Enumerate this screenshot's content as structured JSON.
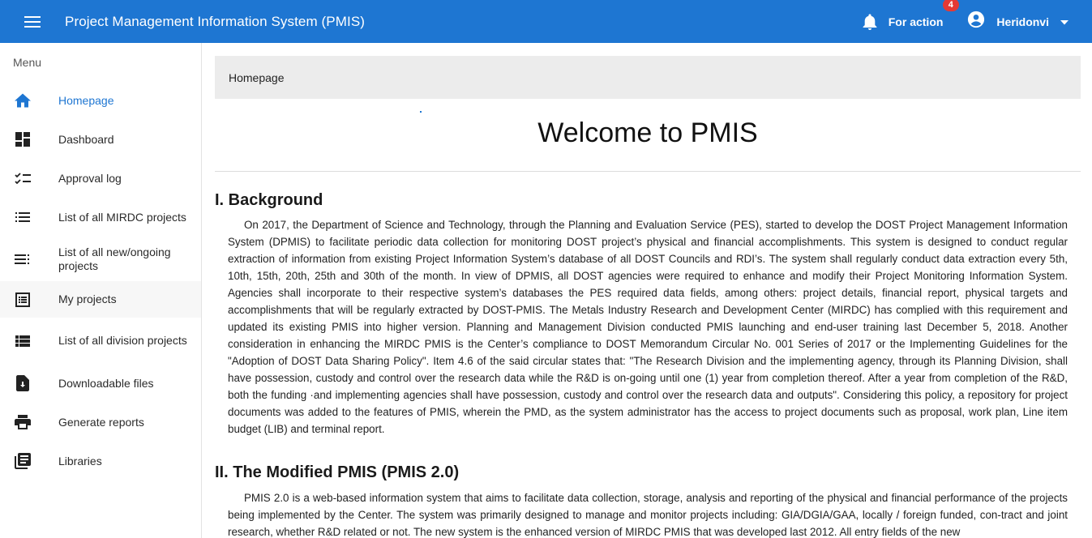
{
  "appbar": {
    "title": "Project Management Information System (PMIS)",
    "for_action_label": "For action",
    "for_action_count": "4",
    "user_name": "Heridonvi"
  },
  "sidebar": {
    "menu_title": "Menu",
    "items": [
      {
        "label": "Homepage",
        "icon": "home-icon"
      },
      {
        "label": "Dashboard",
        "icon": "dashboard-icon"
      },
      {
        "label": "Approval log",
        "icon": "checklist-icon"
      },
      {
        "label": "List of all MIRDC projects",
        "icon": "list-icon"
      },
      {
        "label": "List of all new/ongoing projects",
        "icon": "playlist-icon"
      },
      {
        "label": "My projects",
        "icon": "document-list-icon"
      },
      {
        "label": "List of all division projects",
        "icon": "view-list-icon"
      },
      {
        "label": "Downloadable files",
        "icon": "download-file-icon"
      },
      {
        "label": "Generate reports",
        "icon": "printer-icon"
      },
      {
        "label": "Libraries",
        "icon": "library-icon"
      }
    ]
  },
  "main": {
    "breadcrumb": "Homepage",
    "welcome": "Welcome to PMIS",
    "sections": [
      {
        "title": "I. Background",
        "text": "On 2017, the Department of Science and Technology, through the Planning and Evaluation Service (PES), started to develop the DOST Project Management Information System (DPMIS) to facilitate periodic data collection for monitoring DOST project’s physical and financial accomplishments. This system is designed to conduct regular extraction of information from existing Project Information System’s database of all DOST Councils and RDI’s. The system shall regularly conduct data extraction every 5th, 10th, 15th, 20th, 25th and 30th of the month. In view of DPMIS, all DOST agencies were required to enhance and modify their Project Monitoring Information System. Agencies shall incorporate to their respective system’s databases the PES required data fields, among others: project details, financial report, physical targets and accomplishments that will be regularly extracted by DOST-PMIS. The Metals Industry Research and Development Center (MIRDC) has complied with this requirement and updated its existing PMIS into higher version. Planning and Management Division conducted PMIS launching and end-user training last December 5, 2018. Another consideration in enhancing the MIRDC PMIS is the Center’s compliance to DOST Memorandum Circular No. 001 Series of 2017 or the Implementing Guidelines for the \"Adoption of DOST Data Sharing Policy\". Item 4.6 of the said circular states that: \"The Research Division and the implementing agency, through its Planning Division, shall have possession, custody and control over the research data while the R&D is on-going until one (1) year from completion thereof. After a year from completion of the R&D, both the funding ·and implementing agencies shall have possession, custody and control over the research data and outputs\". Considering this policy, a repository for project documents was added to the features of PMIS, wherein the PMD, as the system administrator has the access to project documents such as proposal, work plan, Line item budget (LIB) and terminal report."
      },
      {
        "title": "II. The Modified PMIS (PMIS 2.0)",
        "text": "PMIS 2.0 is a web-based information system that aims to facilitate data collection, storage, analysis and reporting of the physical and financial performance of the projects being implemented by the Center. The system was primarily designed to manage and monitor projects including: GIA/DGIA/GAA, locally / foreign funded, con-tract and joint research, whether R&D related or not. The new system is the enhanced version of MIRDC PMIS that was developed last 2012. All entry fields of the new"
      }
    ]
  }
}
